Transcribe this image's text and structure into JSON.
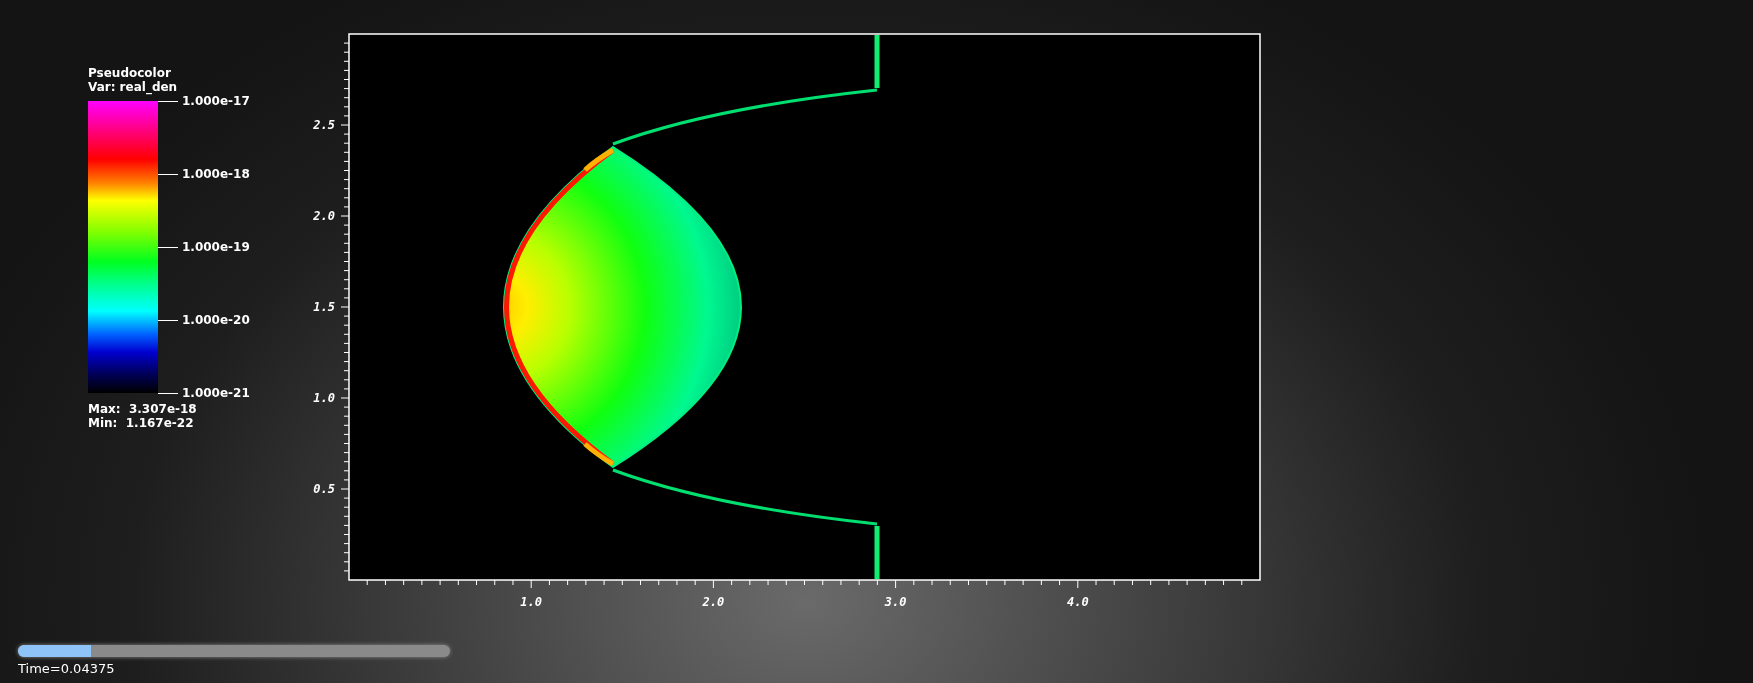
{
  "legend": {
    "title": "Pseudocolor",
    "variable": "Var: real_den",
    "ticks": [
      "1.000e-17",
      "1.000e-18",
      "1.000e-19",
      "1.000e-20",
      "1.000e-21"
    ],
    "max": "Max:  3.307e-18",
    "min": "Min:  1.167e-22"
  },
  "plot": {
    "y_ticks": [
      "2.5",
      "2.0",
      "1.5",
      "1.0",
      "0.5"
    ],
    "x_ticks": [
      "1.0",
      "2.0",
      "3.0",
      "4.0"
    ]
  },
  "time_slider": {
    "level": 0.17,
    "label": "Time=0.04375"
  }
}
